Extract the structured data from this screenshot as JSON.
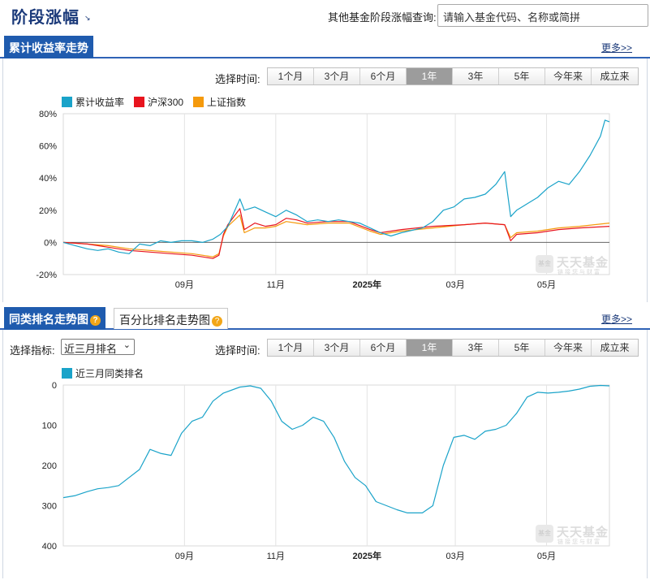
{
  "header": {
    "title": "阶段涨幅",
    "title_arrow": "↘",
    "query_label": "其他基金阶段涨幅查询:",
    "search_placeholder": "请输入基金代码、名称或简拼"
  },
  "section1": {
    "tab_label": "累计收益率走势",
    "more_label": "更多>>",
    "period_label": "选择时间:",
    "periods": [
      "1个月",
      "3个月",
      "6个月",
      "1年",
      "3年",
      "5年",
      "今年来",
      "成立来"
    ],
    "active_period": "1年"
  },
  "section2": {
    "tab_label": "同类排名走势图",
    "tab2_label": "百分比排名走势图",
    "help_glyph": "?",
    "more_label": "更多>>",
    "metric_label": "选择指标:",
    "metric_value": "近三月排名",
    "period_label": "选择时间:",
    "periods": [
      "1个月",
      "3个月",
      "6个月",
      "1年",
      "3年",
      "5年",
      "今年来",
      "成立来"
    ],
    "active_period": "1年"
  },
  "watermark": {
    "badge": "基金",
    "name": "天天基金",
    "sub": "链接您与财富"
  },
  "colors": {
    "brand_blue": "#1f5bae",
    "fund": "#1aa3c9",
    "hs300": "#e8141e",
    "sz": "#f59a0c",
    "rank": "#1aa3c9"
  },
  "chart_data": [
    {
      "type": "line",
      "title": "",
      "xlabel": "",
      "ylabel": "",
      "ylim": [
        -20,
        80
      ],
      "y_ticks": [
        "80%",
        "60%",
        "40%",
        "20%",
        "0%",
        "-20%"
      ],
      "y_tick_values": [
        80,
        60,
        40,
        20,
        0,
        -20
      ],
      "x_range": [
        "2024-06-12",
        "2025-06-12"
      ],
      "x_ticks": [
        {
          "date": "2024-09-01",
          "label": "09月",
          "bold": false
        },
        {
          "date": "2024-11-01",
          "label": "11月",
          "bold": false
        },
        {
          "date": "2025-01-01",
          "label": "2025年",
          "bold": true
        },
        {
          "date": "2025-03-01",
          "label": "03月",
          "bold": false
        },
        {
          "date": "2025-05-01",
          "label": "05月",
          "bold": false
        }
      ],
      "grid": "vertical",
      "legend_position": "top-left",
      "series": [
        {
          "name": "累计收益率",
          "color": "#1aa3c9",
          "points": [
            [
              "2024-06-12",
              0
            ],
            [
              "2024-06-20",
              -2
            ],
            [
              "2024-06-28",
              -4
            ],
            [
              "2024-07-05",
              -5
            ],
            [
              "2024-07-12",
              -4
            ],
            [
              "2024-07-19",
              -6
            ],
            [
              "2024-07-26",
              -7
            ],
            [
              "2024-08-02",
              -1
            ],
            [
              "2024-08-09",
              -2
            ],
            [
              "2024-08-16",
              1
            ],
            [
              "2024-08-23",
              0
            ],
            [
              "2024-08-30",
              1
            ],
            [
              "2024-09-06",
              1
            ],
            [
              "2024-09-13",
              0
            ],
            [
              "2024-09-20",
              2
            ],
            [
              "2024-09-25",
              5
            ],
            [
              "2024-09-30",
              10
            ],
            [
              "2024-10-08",
              27
            ],
            [
              "2024-10-11",
              20
            ],
            [
              "2024-10-18",
              22
            ],
            [
              "2024-10-25",
              19
            ],
            [
              "2024-11-01",
              16
            ],
            [
              "2024-11-08",
              20
            ],
            [
              "2024-11-15",
              17
            ],
            [
              "2024-11-22",
              13
            ],
            [
              "2024-11-29",
              14
            ],
            [
              "2024-12-06",
              13
            ],
            [
              "2024-12-13",
              14
            ],
            [
              "2024-12-20",
              13
            ],
            [
              "2024-12-27",
              12
            ],
            [
              "2025-01-03",
              9
            ],
            [
              "2025-01-10",
              6
            ],
            [
              "2025-01-17",
              4
            ],
            [
              "2025-01-24",
              6
            ],
            [
              "2025-02-07",
              9
            ],
            [
              "2025-02-14",
              13
            ],
            [
              "2025-02-21",
              20
            ],
            [
              "2025-02-28",
              22
            ],
            [
              "2025-03-07",
              27
            ],
            [
              "2025-03-14",
              28
            ],
            [
              "2025-03-21",
              30
            ],
            [
              "2025-03-28",
              36
            ],
            [
              "2025-04-03",
              44
            ],
            [
              "2025-04-07",
              16
            ],
            [
              "2025-04-11",
              20
            ],
            [
              "2025-04-18",
              24
            ],
            [
              "2025-04-25",
              28
            ],
            [
              "2025-05-02",
              34
            ],
            [
              "2025-05-09",
              38
            ],
            [
              "2025-05-16",
              36
            ],
            [
              "2025-05-23",
              44
            ],
            [
              "2025-05-30",
              54
            ],
            [
              "2025-06-06",
              66
            ],
            [
              "2025-06-09",
              76
            ],
            [
              "2025-06-12",
              75
            ]
          ]
        },
        {
          "name": "沪深300",
          "color": "#e8141e",
          "points": [
            [
              "2024-06-12",
              0
            ],
            [
              "2024-06-28",
              -1
            ],
            [
              "2024-07-12",
              -3
            ],
            [
              "2024-07-26",
              -5
            ],
            [
              "2024-08-09",
              -6
            ],
            [
              "2024-08-23",
              -7
            ],
            [
              "2024-09-06",
              -8
            ],
            [
              "2024-09-13",
              -9
            ],
            [
              "2024-09-20",
              -10
            ],
            [
              "2024-09-24",
              -8
            ],
            [
              "2024-09-27",
              5
            ],
            [
              "2024-09-30",
              11
            ],
            [
              "2024-10-08",
              21
            ],
            [
              "2024-10-11",
              8
            ],
            [
              "2024-10-18",
              12
            ],
            [
              "2024-10-25",
              10
            ],
            [
              "2024-11-01",
              11
            ],
            [
              "2024-11-08",
              15
            ],
            [
              "2024-11-15",
              14
            ],
            [
              "2024-11-22",
              12
            ],
            [
              "2024-12-06",
              13
            ],
            [
              "2024-12-20",
              13
            ],
            [
              "2025-01-03",
              8
            ],
            [
              "2025-01-10",
              6
            ],
            [
              "2025-01-24",
              8
            ],
            [
              "2025-02-14",
              10
            ],
            [
              "2025-03-07",
              11
            ],
            [
              "2025-03-21",
              12
            ],
            [
              "2025-04-03",
              11
            ],
            [
              "2025-04-07",
              1
            ],
            [
              "2025-04-11",
              5
            ],
            [
              "2025-04-25",
              6
            ],
            [
              "2025-05-09",
              8
            ],
            [
              "2025-05-23",
              9
            ],
            [
              "2025-06-12",
              10
            ]
          ]
        },
        {
          "name": "上证指数",
          "color": "#f59a0c",
          "points": [
            [
              "2024-06-12",
              0
            ],
            [
              "2024-06-28",
              -1
            ],
            [
              "2024-07-12",
              -2
            ],
            [
              "2024-07-26",
              -4
            ],
            [
              "2024-08-09",
              -5
            ],
            [
              "2024-08-23",
              -6
            ],
            [
              "2024-09-06",
              -7
            ],
            [
              "2024-09-13",
              -8
            ],
            [
              "2024-09-20",
              -9
            ],
            [
              "2024-09-24",
              -7
            ],
            [
              "2024-09-27",
              4
            ],
            [
              "2024-09-30",
              10
            ],
            [
              "2024-10-08",
              17
            ],
            [
              "2024-10-11",
              6
            ],
            [
              "2024-10-18",
              9
            ],
            [
              "2024-10-25",
              9
            ],
            [
              "2024-11-01",
              10
            ],
            [
              "2024-11-08",
              13
            ],
            [
              "2024-11-15",
              12
            ],
            [
              "2024-11-22",
              11
            ],
            [
              "2024-12-06",
              12
            ],
            [
              "2024-12-20",
              12
            ],
            [
              "2025-01-03",
              7
            ],
            [
              "2025-01-10",
              5
            ],
            [
              "2025-01-24",
              7
            ],
            [
              "2025-02-14",
              9
            ],
            [
              "2025-03-07",
              11
            ],
            [
              "2025-03-21",
              12
            ],
            [
              "2025-04-03",
              11
            ],
            [
              "2025-04-07",
              3
            ],
            [
              "2025-04-11",
              6
            ],
            [
              "2025-04-25",
              7
            ],
            [
              "2025-05-09",
              9
            ],
            [
              "2025-05-23",
              10
            ],
            [
              "2025-06-12",
              12
            ]
          ]
        }
      ]
    },
    {
      "type": "line",
      "title": "",
      "xlabel": "",
      "ylabel": "",
      "ylim": [
        0,
        400
      ],
      "y_inverted": true,
      "y_ticks": [
        "0",
        "100",
        "200",
        "300",
        "400"
      ],
      "y_tick_values": [
        0,
        100,
        200,
        300,
        400
      ],
      "x_range": [
        "2024-06-12",
        "2025-06-12"
      ],
      "x_ticks": [
        {
          "date": "2024-09-01",
          "label": "09月",
          "bold": false
        },
        {
          "date": "2024-11-01",
          "label": "11月",
          "bold": false
        },
        {
          "date": "2025-01-01",
          "label": "2025年",
          "bold": true
        },
        {
          "date": "2025-03-01",
          "label": "03月",
          "bold": false
        },
        {
          "date": "2025-05-01",
          "label": "05月",
          "bold": false
        }
      ],
      "grid": "vertical",
      "legend_position": "top-left",
      "series": [
        {
          "name": "近三月同类排名",
          "color": "#1aa3c9",
          "points": [
            [
              "2024-06-12",
              280
            ],
            [
              "2024-06-20",
              275
            ],
            [
              "2024-06-28",
              265
            ],
            [
              "2024-07-05",
              258
            ],
            [
              "2024-07-12",
              255
            ],
            [
              "2024-07-19",
              250
            ],
            [
              "2024-07-26",
              230
            ],
            [
              "2024-08-02",
              210
            ],
            [
              "2024-08-09",
              160
            ],
            [
              "2024-08-16",
              170
            ],
            [
              "2024-08-23",
              175
            ],
            [
              "2024-08-30",
              120
            ],
            [
              "2024-09-06",
              90
            ],
            [
              "2024-09-13",
              80
            ],
            [
              "2024-09-20",
              40
            ],
            [
              "2024-09-27",
              20
            ],
            [
              "2024-10-08",
              5
            ],
            [
              "2024-10-15",
              2
            ],
            [
              "2024-10-22",
              8
            ],
            [
              "2024-10-29",
              40
            ],
            [
              "2024-11-05",
              90
            ],
            [
              "2024-11-12",
              110
            ],
            [
              "2024-11-19",
              100
            ],
            [
              "2024-11-26",
              80
            ],
            [
              "2024-12-03",
              90
            ],
            [
              "2024-12-10",
              130
            ],
            [
              "2024-12-17",
              190
            ],
            [
              "2024-12-24",
              230
            ],
            [
              "2024-12-31",
              250
            ],
            [
              "2025-01-07",
              290
            ],
            [
              "2025-01-14",
              300
            ],
            [
              "2025-01-21",
              310
            ],
            [
              "2025-01-28",
              318
            ],
            [
              "2025-02-07",
              318
            ],
            [
              "2025-02-14",
              300
            ],
            [
              "2025-02-21",
              200
            ],
            [
              "2025-02-28",
              130
            ],
            [
              "2025-03-07",
              125
            ],
            [
              "2025-03-14",
              135
            ],
            [
              "2025-03-21",
              115
            ],
            [
              "2025-03-28",
              110
            ],
            [
              "2025-04-04",
              100
            ],
            [
              "2025-04-11",
              70
            ],
            [
              "2025-04-18",
              30
            ],
            [
              "2025-04-25",
              18
            ],
            [
              "2025-05-02",
              20
            ],
            [
              "2025-05-09",
              18
            ],
            [
              "2025-05-16",
              15
            ],
            [
              "2025-05-23",
              10
            ],
            [
              "2025-05-30",
              3
            ],
            [
              "2025-06-06",
              1
            ],
            [
              "2025-06-12",
              2
            ]
          ]
        }
      ]
    }
  ]
}
